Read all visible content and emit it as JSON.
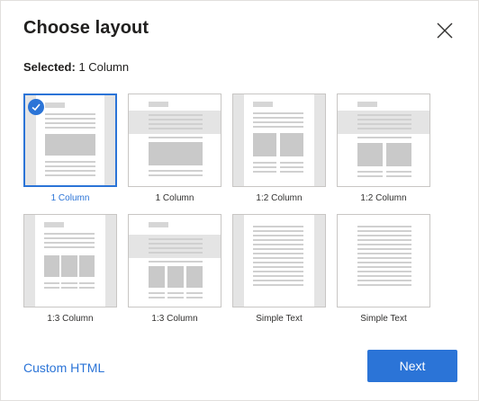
{
  "dialog": {
    "title": "Choose layout",
    "selected_label": "Selected:",
    "selected_value": "1 Column",
    "accent_color": "#2b74d7"
  },
  "layouts": [
    {
      "label": "1 Column",
      "selected": true
    },
    {
      "label": "1 Column",
      "selected": false
    },
    {
      "label": "1:2 Column",
      "selected": false
    },
    {
      "label": "1:2 Column",
      "selected": false
    },
    {
      "label": "1:3 Column",
      "selected": false
    },
    {
      "label": "1:3 Column",
      "selected": false
    },
    {
      "label": "Simple Text",
      "selected": false
    },
    {
      "label": "Simple Text",
      "selected": false
    }
  ],
  "footer": {
    "custom_html_label": "Custom HTML",
    "next_label": "Next"
  },
  "icons": {
    "close": "close-icon",
    "check": "checkmark-icon"
  }
}
